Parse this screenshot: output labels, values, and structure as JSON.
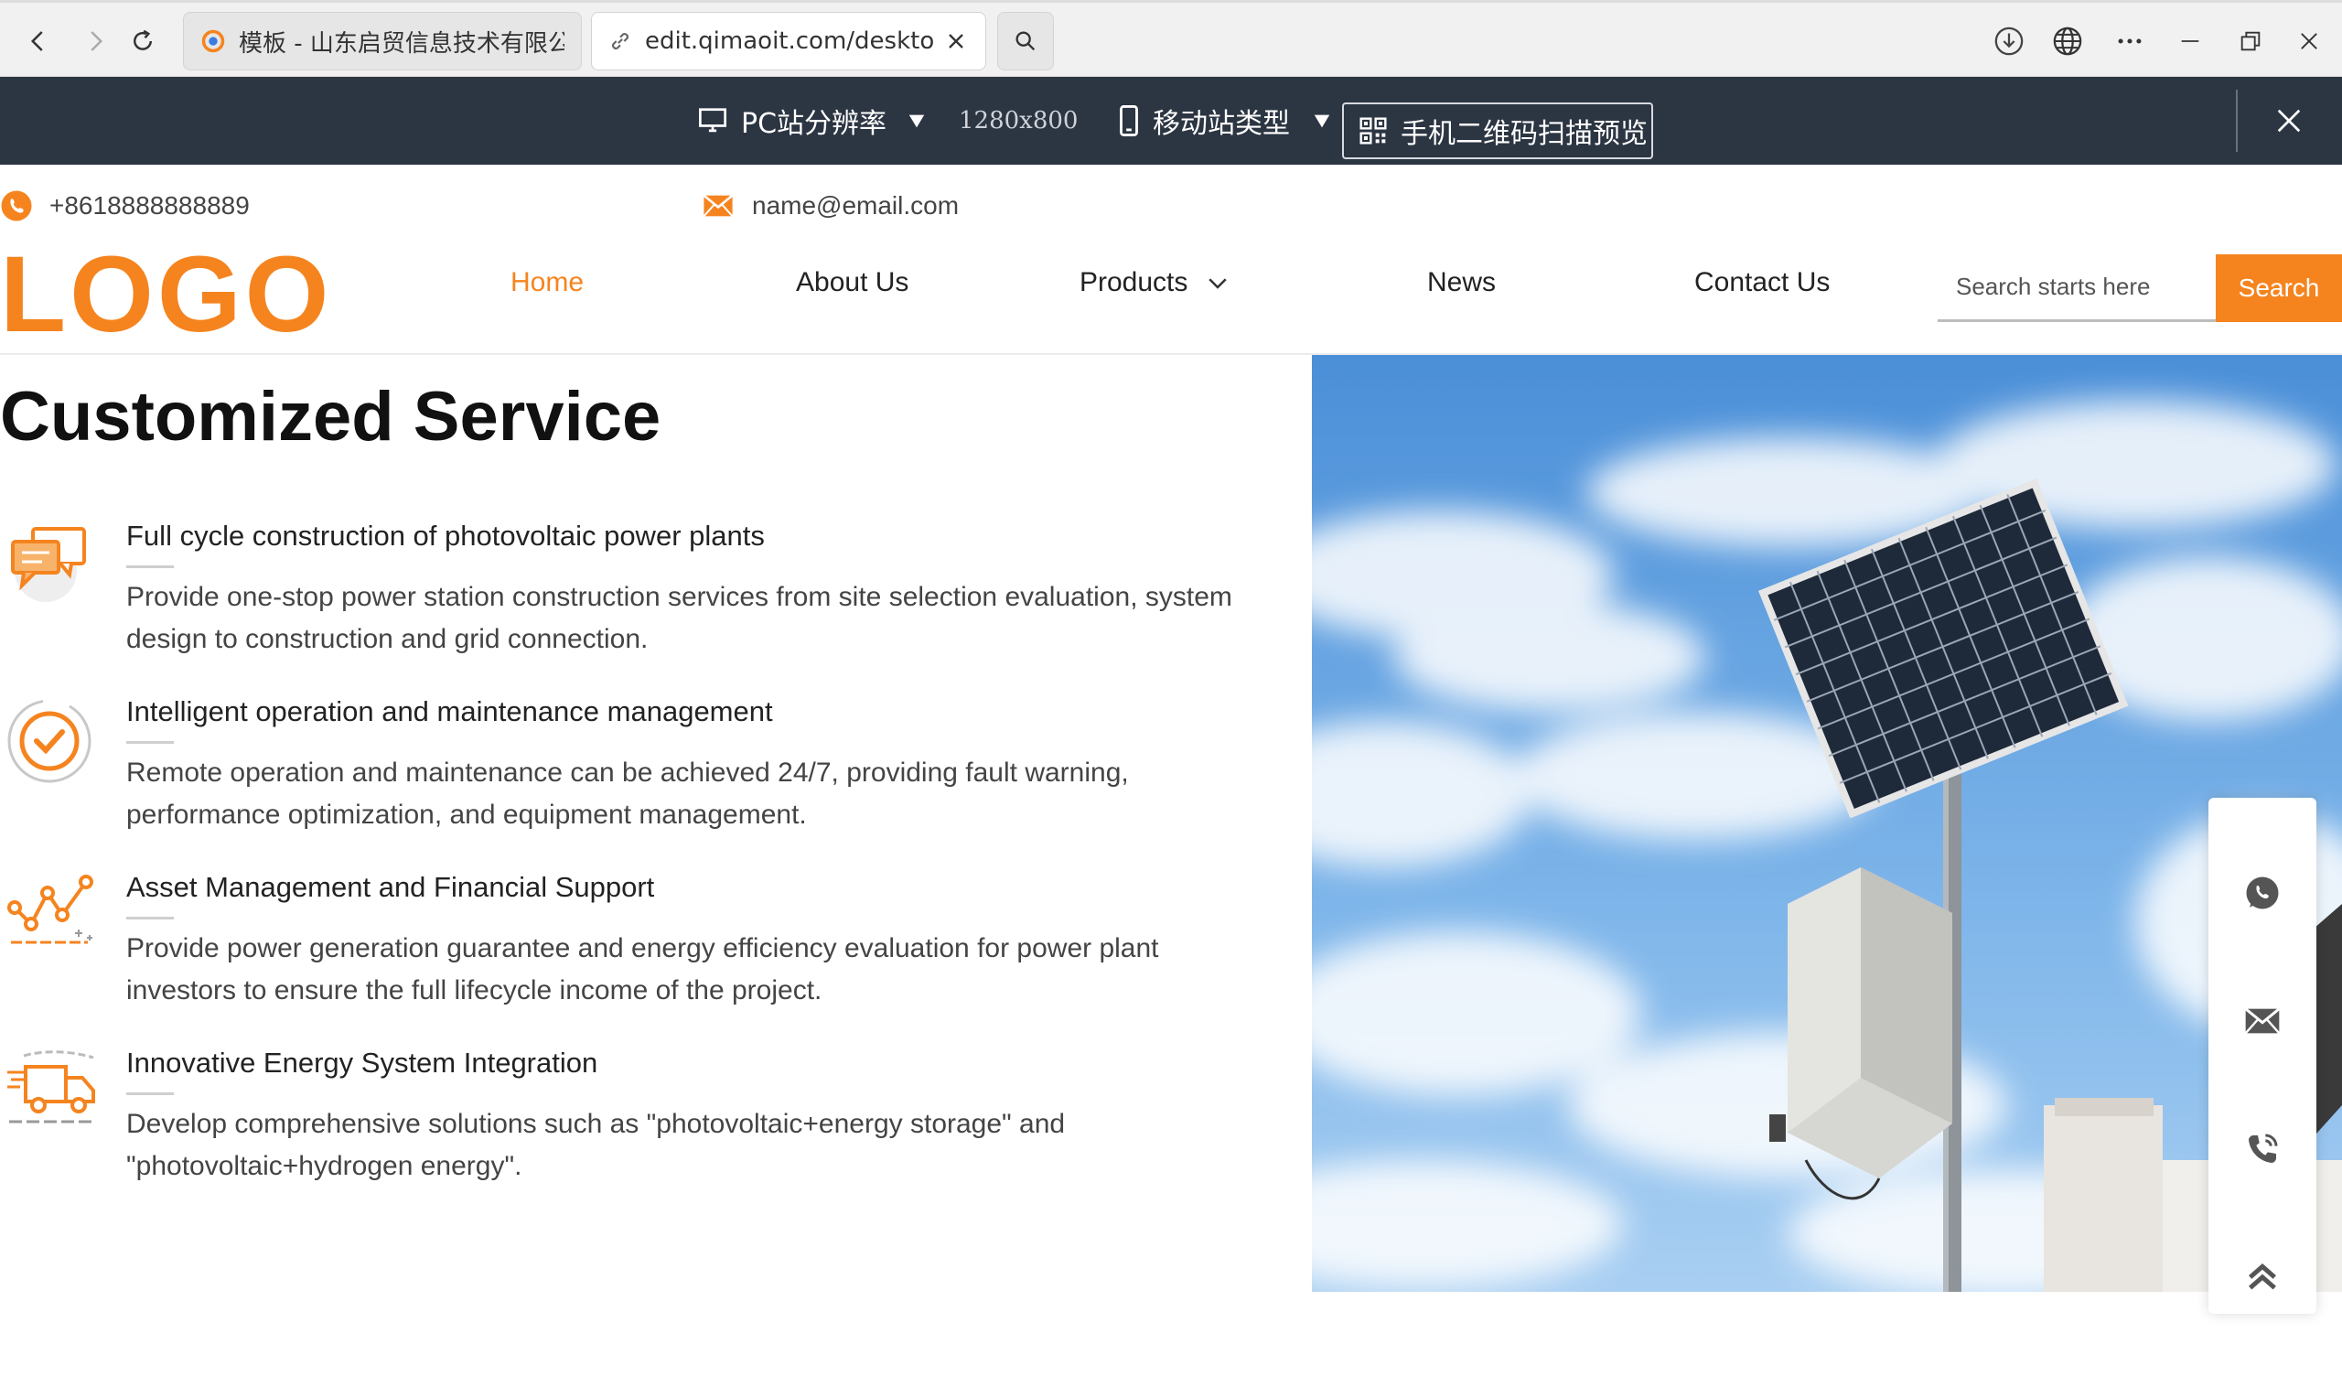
{
  "browser": {
    "tabs": [
      {
        "label": "模板 - 山东启贸信息技术有限公司",
        "active": false
      },
      {
        "label": "edit.qimaoit.com/desktop/h",
        "active": true
      }
    ]
  },
  "editor_toolbar": {
    "pc_resolution_label": "PC站分辨率",
    "resolution_value": "1280x800",
    "mobile_type_label": "移动站类型",
    "qr_preview_label": "手机二维码扫描预览"
  },
  "header": {
    "phone": "+8618888888889",
    "email": "name@email.com",
    "logo": "LOGO",
    "nav": [
      {
        "label": "Home",
        "active": true
      },
      {
        "label": "About Us"
      },
      {
        "label": "Products",
        "has_dropdown": true
      },
      {
        "label": "News"
      },
      {
        "label": "Contact Us"
      }
    ],
    "search": {
      "placeholder": "Search starts here",
      "button": "Search"
    }
  },
  "main": {
    "title": "Customized Service",
    "services": [
      {
        "title": "Full cycle construction of photovoltaic power plants",
        "desc": "Provide one-stop power station construction services from site selection evaluation, system design to construction and grid connection.",
        "icon": "chat-bubbles-icon"
      },
      {
        "title": "Intelligent operation and maintenance management",
        "desc": "Remote operation and maintenance can be achieved 24/7, providing fault warning, performance optimization, and equipment management.",
        "icon": "check-circle-icon"
      },
      {
        "title": "Asset Management and Financial Support",
        "desc": "Provide power generation guarantee and energy efficiency evaluation for power plant investors to ensure the full lifecycle income of the project.",
        "icon": "trend-chart-icon"
      },
      {
        "title": "Innovative Energy System Integration",
        "desc": "Develop comprehensive solutions such as \"photovoltaic+energy storage\" and \"photovoltaic+hydrogen energy\".",
        "icon": "delivery-truck-icon"
      }
    ]
  },
  "colors": {
    "accent": "#f5841f",
    "editor_bar": "#2c3542",
    "sky": "#5a9ee0"
  }
}
